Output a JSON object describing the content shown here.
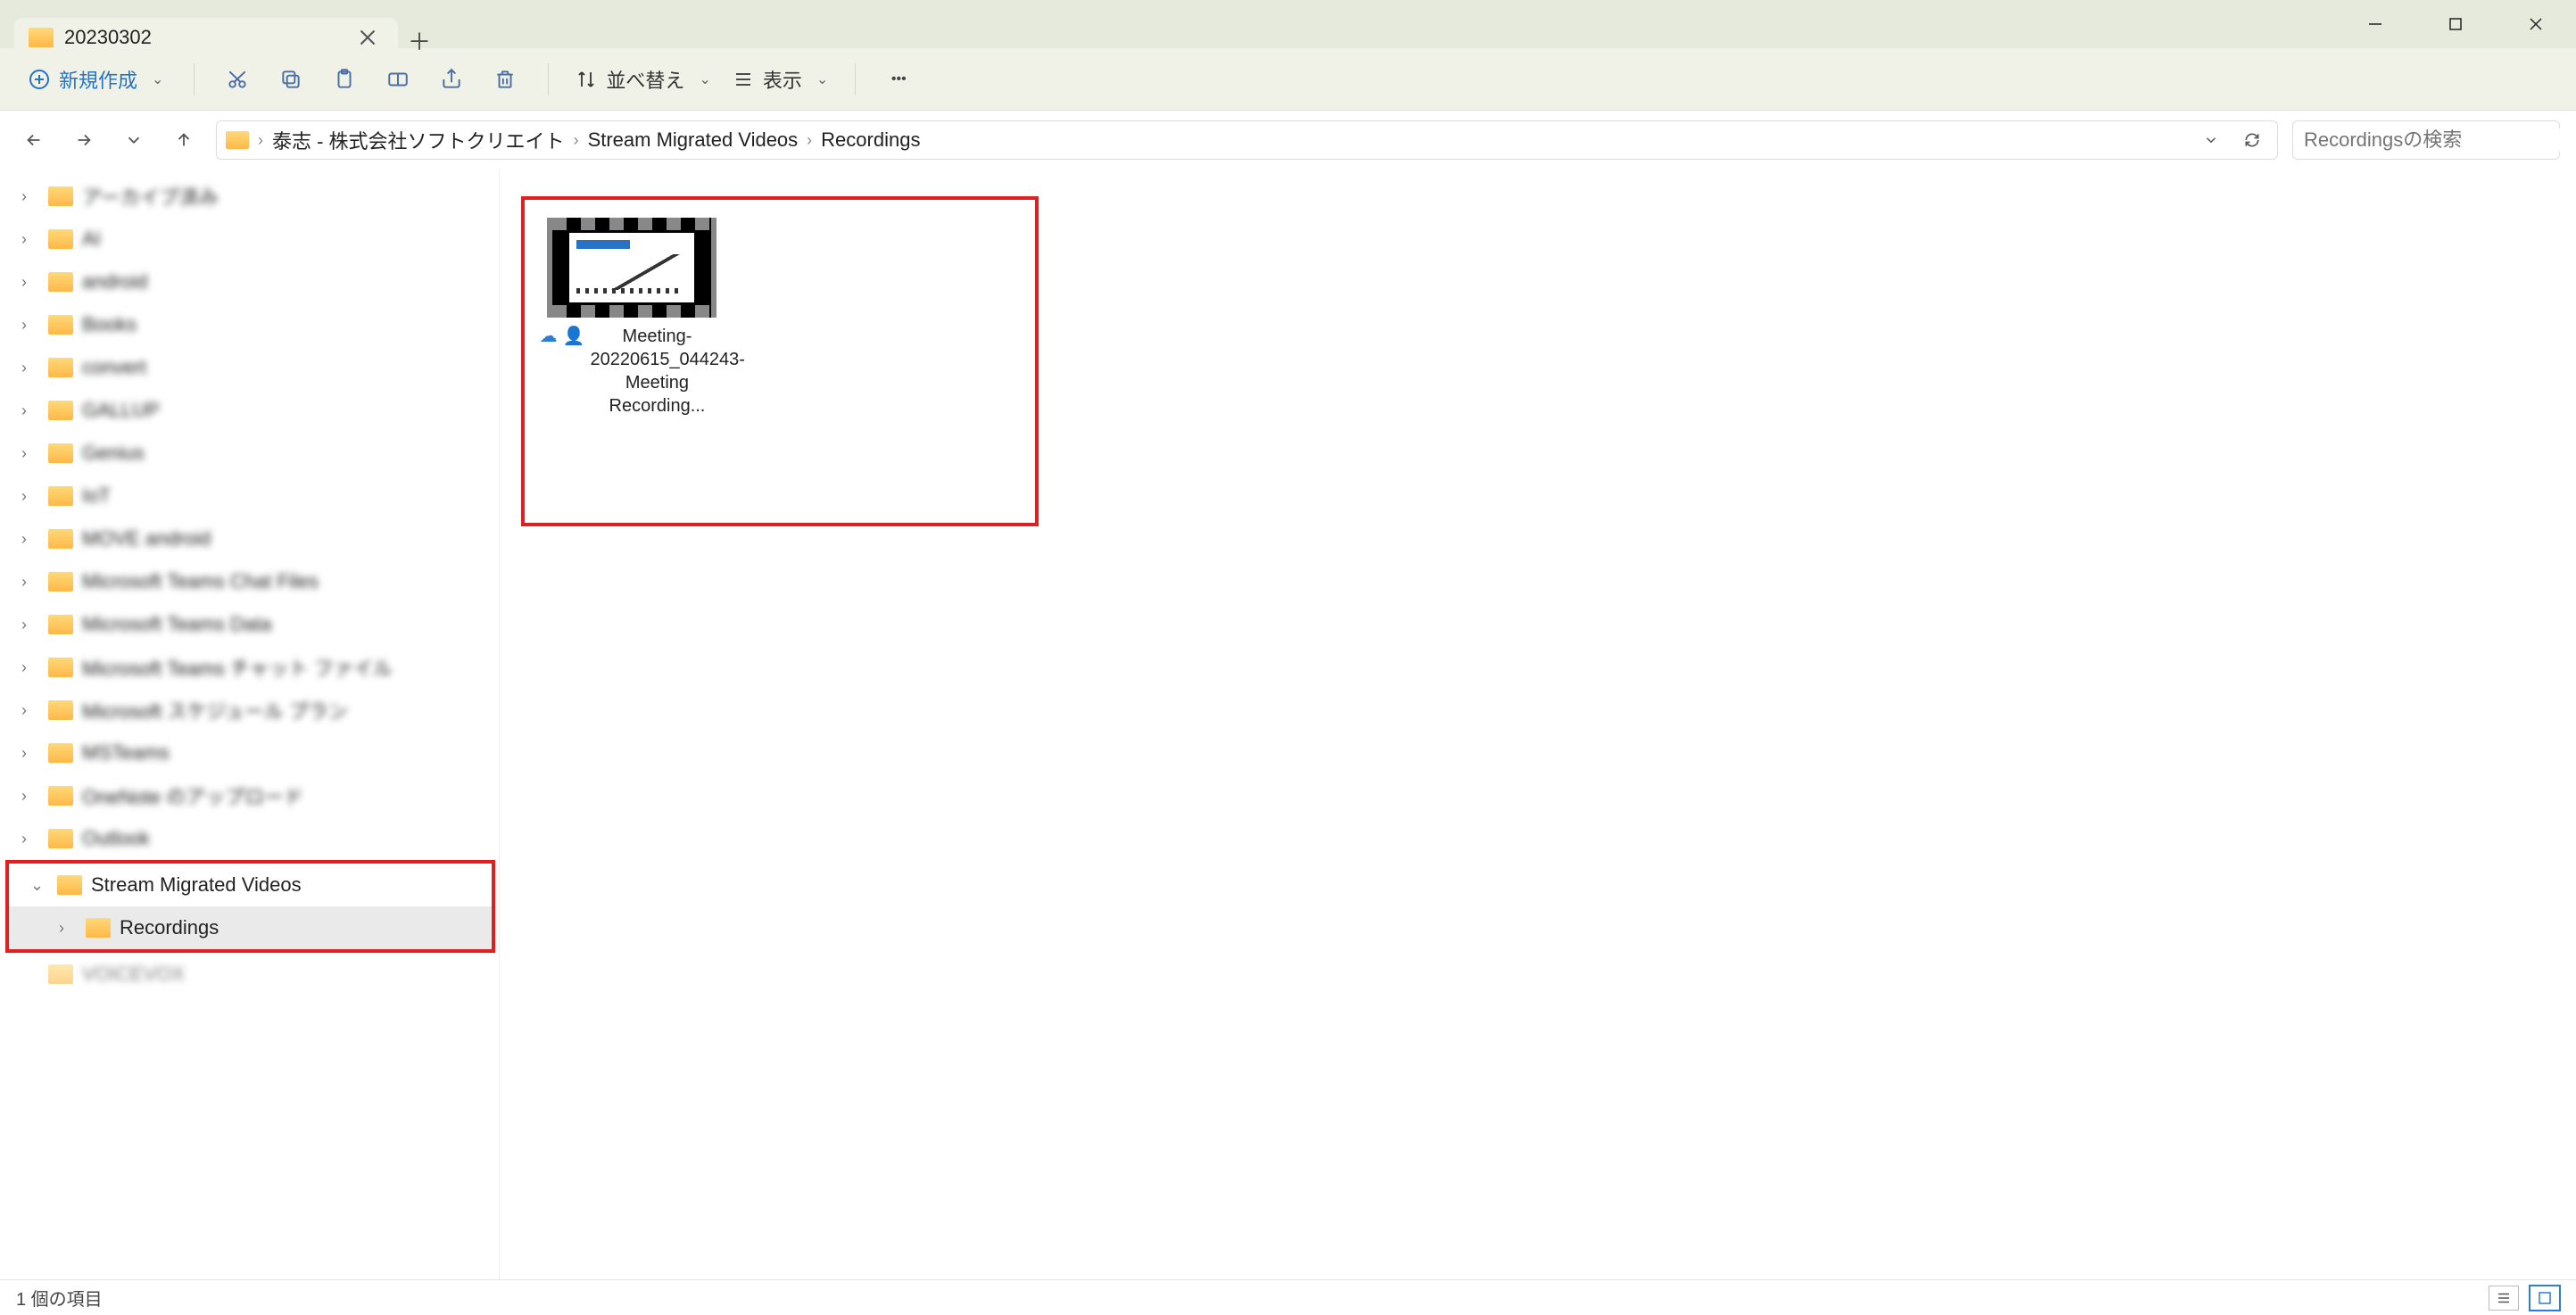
{
  "tab": {
    "title": "20230302"
  },
  "toolbar": {
    "new_label": "新規作成",
    "sort_label": "並べ替え",
    "view_label": "表示"
  },
  "breadcrumb": [
    "泰志 - 株式会社ソフトクリエイト",
    "Stream Migrated Videos",
    "Recordings"
  ],
  "search": {
    "placeholder": "Recordingsの検索"
  },
  "sidebar": {
    "items": [
      {
        "label": "アーカイブ済み",
        "blur": true
      },
      {
        "label": "AI",
        "blur": true
      },
      {
        "label": "android",
        "blur": true
      },
      {
        "label": "Books",
        "blur": true
      },
      {
        "label": "convert",
        "blur": true
      },
      {
        "label": "GALLUP",
        "blur": true
      },
      {
        "label": "Genius",
        "blur": true
      },
      {
        "label": "IoT",
        "blur": true
      },
      {
        "label": "MOVE android",
        "blur": true
      },
      {
        "label": "Microsoft Teams Chat Files",
        "blur": true
      },
      {
        "label": "Microsoft Teams Data",
        "blur": true
      },
      {
        "label": "Microsoft Teams チャット ファイル",
        "blur": true
      },
      {
        "label": "Microsoft スケジュール プラン",
        "blur": true
      },
      {
        "label": "MSTeams",
        "blur": true
      },
      {
        "label": "OneNote のアップロード",
        "blur": true
      },
      {
        "label": "Outlook",
        "blur": true
      }
    ],
    "highlighted": {
      "parent": "Stream Migrated Videos",
      "child": "Recordings"
    },
    "last_visible": "VOICEVOX"
  },
  "files": [
    {
      "name": "Meeting-20220615_044243-Meeting Recording..."
    }
  ],
  "status": {
    "count_label": "1 個の項目"
  }
}
